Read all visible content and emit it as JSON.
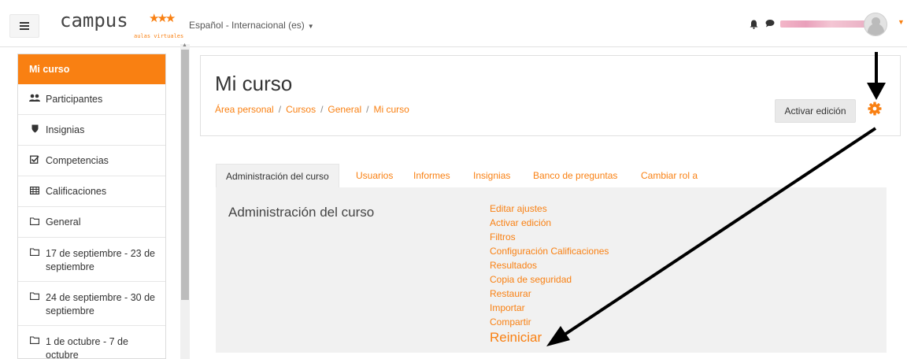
{
  "navbar": {
    "logo_text": "campus",
    "logo_stars": "★★★",
    "logo_sub": "aulas virtuales",
    "language": "Español - Internacional (es)",
    "icons": [
      "menu-icon",
      "bell-icon",
      "chat-icon",
      "avatar",
      "caret-down-icon"
    ]
  },
  "sidebar": {
    "items": [
      {
        "label": "Mi curso",
        "icon": ""
      },
      {
        "label": "Participantes",
        "icon": "users-icon"
      },
      {
        "label": "Insignias",
        "icon": "shield-icon"
      },
      {
        "label": "Competencias",
        "icon": "checkbox-icon"
      },
      {
        "label": "Calificaciones",
        "icon": "table-icon"
      },
      {
        "label": "General",
        "icon": "folder-icon"
      },
      {
        "label": "17 de septiembre - 23 de septiembre",
        "icon": "folder-icon"
      },
      {
        "label": "24 de septiembre - 30 de septiembre",
        "icon": "folder-icon"
      },
      {
        "label": "1 de octubre - 7 de octubre",
        "icon": "folder-icon"
      }
    ]
  },
  "header": {
    "title": "Mi curso",
    "breadcrumb": [
      "Área personal",
      "Cursos",
      "General",
      "Mi curso"
    ],
    "edit_button": "Activar edición"
  },
  "tabs": [
    "Administración del curso",
    "Usuarios",
    "Informes",
    "Insignias",
    "Banco de preguntas",
    "Cambiar rol a"
  ],
  "panel": {
    "title": "Administración del curso",
    "links": [
      "Editar ajustes",
      "Activar edición",
      "Filtros",
      "Configuración Calificaciones",
      "Resultados",
      "Copia de seguridad",
      "Restaurar",
      "Importar",
      "Compartir",
      "Reiniciar"
    ]
  },
  "colors": {
    "accent": "#f98012",
    "panel_bg": "#f1f1f1"
  }
}
